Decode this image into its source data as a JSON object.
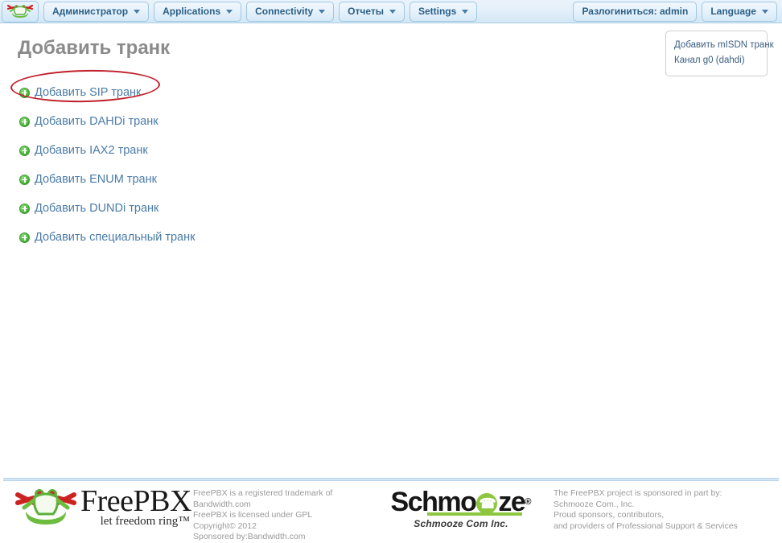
{
  "topnav": {
    "logo_icon": "freepbx-frog-logo",
    "items": [
      {
        "label": "Администратор",
        "has_caret": true
      },
      {
        "label": "Applications",
        "has_caret": true
      },
      {
        "label": "Connectivity",
        "has_caret": true
      },
      {
        "label": "Отчеты",
        "has_caret": true
      },
      {
        "label": "Settings",
        "has_caret": true
      }
    ],
    "right_items": [
      {
        "label": "Разлогиниться: admin",
        "has_caret": false
      },
      {
        "label": "Language",
        "has_caret": true
      }
    ]
  },
  "main": {
    "title": "Добавить транк",
    "trunk_links": [
      {
        "label": "Добавить SIP транк",
        "icon": "add-circle-icon",
        "highlighted": true
      },
      {
        "label": "Добавить DAHDi транк",
        "icon": "add-circle-icon",
        "highlighted": false
      },
      {
        "label": "Добавить IAX2 транк",
        "icon": "add-circle-icon",
        "highlighted": false
      },
      {
        "label": "Добавить ENUM транк",
        "icon": "add-circle-icon",
        "highlighted": false
      },
      {
        "label": "Добавить DUNDi транк",
        "icon": "add-circle-icon",
        "highlighted": false
      },
      {
        "label": "Добавить специальный транк",
        "icon": "add-circle-icon",
        "highlighted": false
      }
    ],
    "annotation": {
      "shape": "ellipse",
      "color": "#c0202a",
      "targets": "Добавить SIP транк"
    }
  },
  "side_panel": {
    "items": [
      "Добавить mISDN транк",
      "Канал g0 (dahdi)"
    ]
  },
  "footer": {
    "freepbx_logo": {
      "wordmark": "FreePBX",
      "tagline": "let freedom ring™"
    },
    "left_text": [
      "FreePBX is a registered trademark of Bandwidth.com",
      "FreePBX is licensed under GPL",
      "Copyright© 2012",
      "Sponsored by:Bandwidth.com"
    ],
    "schmooze_logo": {
      "word_start": "Schmo",
      "word_end": "ze",
      "registered": "®",
      "subtitle": "Schmooze Com Inc."
    },
    "right_text": [
      "The FreePBX project is sponsored in part by:",
      "Schmooze Com., Inc.",
      "Proud sponsors, contributors,",
      "and providers of Professional Support & Services"
    ]
  },
  "colors": {
    "nav_border": "#9fc7e2",
    "nav_text": "#2a5f87",
    "link": "#4a7ba7",
    "title": "#8b8b8b",
    "annotation_red": "#c0202a",
    "icon_green": "#4fb73f",
    "schmooze_green": "#8dc63f",
    "footer_text": "#9a9a9a"
  }
}
